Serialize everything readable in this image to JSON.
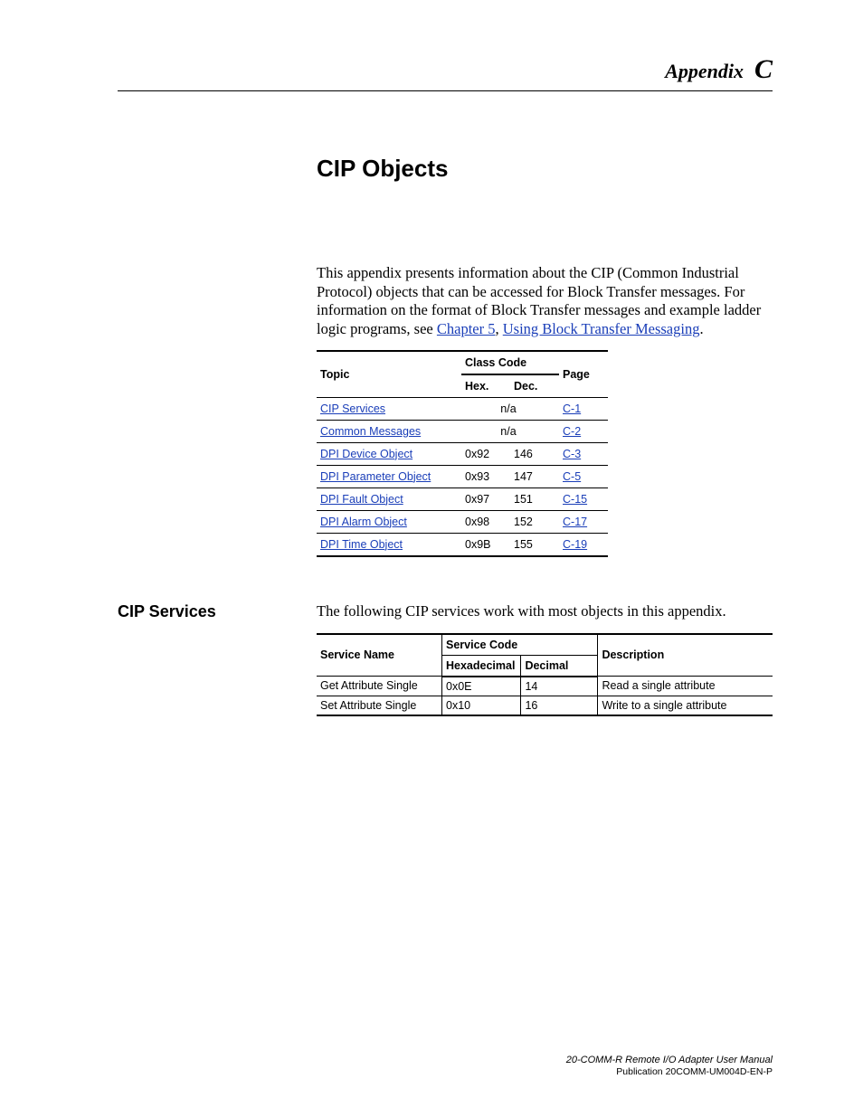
{
  "header": {
    "appendix_word": "Appendix",
    "appendix_letter": "C"
  },
  "title": "CIP Objects",
  "intro": {
    "part1": "This appendix presents information about the CIP (Common Industrial Protocol) objects that can be accessed for Block Transfer messages. For information on the format of Block Transfer messages and example ladder logic programs, see ",
    "link1": "Chapter 5",
    "sep": ", ",
    "link2": "Using Block Transfer Messaging",
    "part2": "."
  },
  "topic_table": {
    "headers": {
      "topic": "Topic",
      "class_code": "Class Code",
      "page": "Page",
      "hex": "Hex.",
      "dec": "Dec."
    },
    "rows": [
      {
        "topic": "CIP Services",
        "hex": "n/a",
        "dec": "",
        "na": true,
        "page": "C-1"
      },
      {
        "topic": "Common Messages",
        "hex": "n/a",
        "dec": "",
        "na": true,
        "page": "C-2"
      },
      {
        "topic": "DPI Device Object",
        "hex": "0x92",
        "dec": "146",
        "na": false,
        "page": "C-3"
      },
      {
        "topic": "DPI Parameter Object",
        "hex": "0x93",
        "dec": "147",
        "na": false,
        "page": "C-5"
      },
      {
        "topic": "DPI Fault Object",
        "hex": "0x97",
        "dec": "151",
        "na": false,
        "page": "C-15"
      },
      {
        "topic": "DPI Alarm Object",
        "hex": "0x98",
        "dec": "152",
        "na": false,
        "page": "C-17"
      },
      {
        "topic": "DPI Time Object",
        "hex": "0x9B",
        "dec": "155",
        "na": false,
        "page": "C-19"
      }
    ]
  },
  "section": {
    "heading": "CIP Services",
    "intro": "The following CIP services work with most objects in this appendix."
  },
  "services_table": {
    "headers": {
      "name": "Service Name",
      "code": "Service Code",
      "desc": "Description",
      "hex": "Hexadecimal",
      "dec": "Decimal"
    },
    "rows": [
      {
        "name": "Get Attribute Single",
        "hex": "0x0E",
        "dec": "14",
        "desc": "Read a single attribute"
      },
      {
        "name": "Set Attribute Single",
        "hex": "0x10",
        "dec": "16",
        "desc": "Write to a single attribute"
      }
    ]
  },
  "footer": {
    "line1": "20-COMM-R Remote I/O Adapter User Manual",
    "line2": "Publication 20COMM-UM004D-EN-P"
  }
}
